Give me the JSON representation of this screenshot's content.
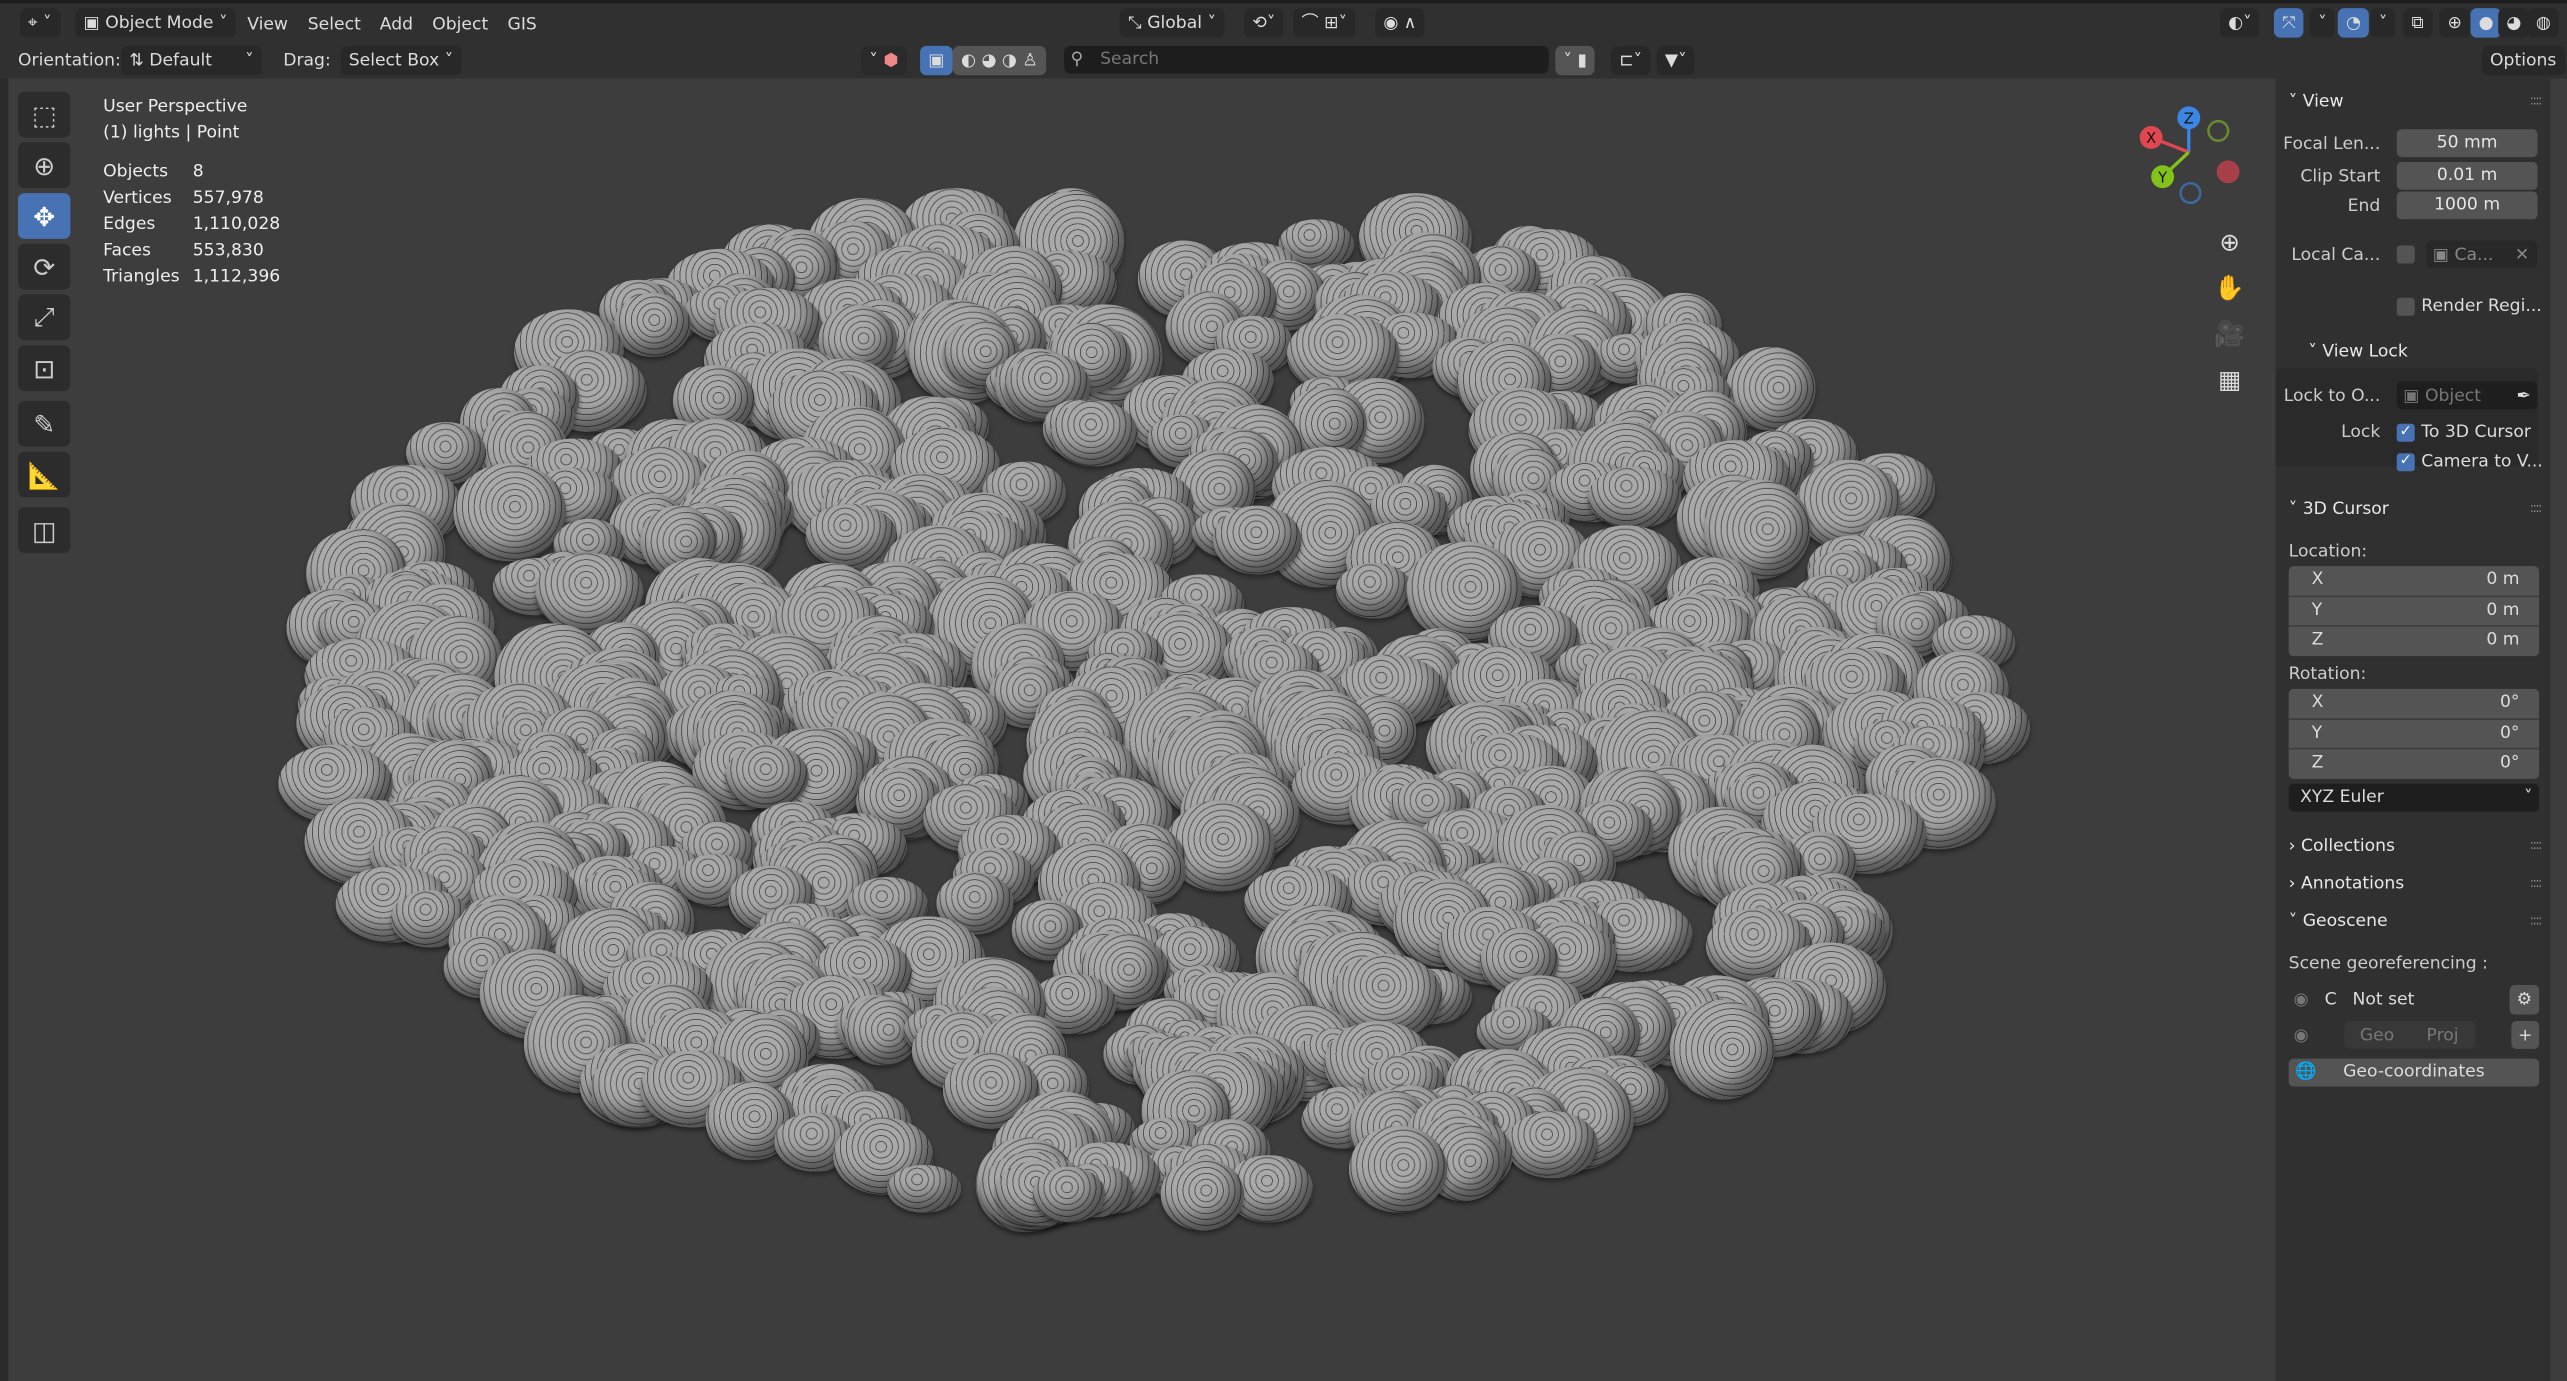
{
  "header": {
    "mode": "Object Mode",
    "menus": [
      "View",
      "Select",
      "Add",
      "Object",
      "GIS"
    ],
    "transform_orientation": "Global",
    "options_label": "Options"
  },
  "toolbar2": {
    "orientation_label": "Orientation:",
    "orientation_value": "Default",
    "drag_label": "Drag:",
    "drag_value": "Select Box",
    "search_placeholder": "Search"
  },
  "overlay": {
    "view_name": "User Perspective",
    "collection": "(1) lights | Point",
    "stats": [
      {
        "label": "Objects",
        "value": "8"
      },
      {
        "label": "Vertices",
        "value": "557,978"
      },
      {
        "label": "Edges",
        "value": "1,110,028"
      },
      {
        "label": "Faces",
        "value": "553,830"
      },
      {
        "label": "Triangles",
        "value": "1,112,396"
      }
    ]
  },
  "gizmo": {
    "x": "X",
    "y": "Y",
    "z": "Z"
  },
  "panel": {
    "view": {
      "title": "View",
      "focal_label": "Focal Len...",
      "focal_value": "50 mm",
      "clip_start_label": "Clip Start",
      "clip_start_value": "0.01 m",
      "end_label": "End",
      "end_value": "1000 m",
      "local_camera_label": "Local Ca...",
      "local_camera_value": "Ca...",
      "render_region_label": "Render Regi..."
    },
    "view_lock": {
      "title": "View Lock",
      "lock_to_label": "Lock to O...",
      "lock_to_placeholder": "Object",
      "lock_label": "Lock",
      "to_cursor_label": "To 3D Cursor",
      "to_cursor_checked": true,
      "camera_label": "Camera to V...",
      "camera_checked": true
    },
    "cursor": {
      "title": "3D Cursor",
      "location_label": "Location:",
      "location": [
        {
          "axis": "X",
          "value": "0 m"
        },
        {
          "axis": "Y",
          "value": "0 m"
        },
        {
          "axis": "Z",
          "value": "0 m"
        }
      ],
      "rotation_label": "Rotation:",
      "rotation": [
        {
          "axis": "X",
          "value": "0°"
        },
        {
          "axis": "Y",
          "value": "0°"
        },
        {
          "axis": "Z",
          "value": "0°"
        }
      ],
      "rotation_mode": "XYZ Euler"
    },
    "collections_title": "Collections",
    "annotations_title": "Annotations",
    "geoscene": {
      "title": "Geoscene",
      "georef_label": "Scene georeferencing :",
      "crs_prefix": "C",
      "crs_value": "Not set",
      "geo_label": "Geo",
      "proj_label": "Proj",
      "add_label": "+",
      "geocoords_label": "Geo-coordinates"
    }
  },
  "colors": {
    "accent": "#4772b3",
    "x_axis": "#e0474f",
    "y_axis": "#82c21b",
    "z_axis": "#3b86e2"
  }
}
